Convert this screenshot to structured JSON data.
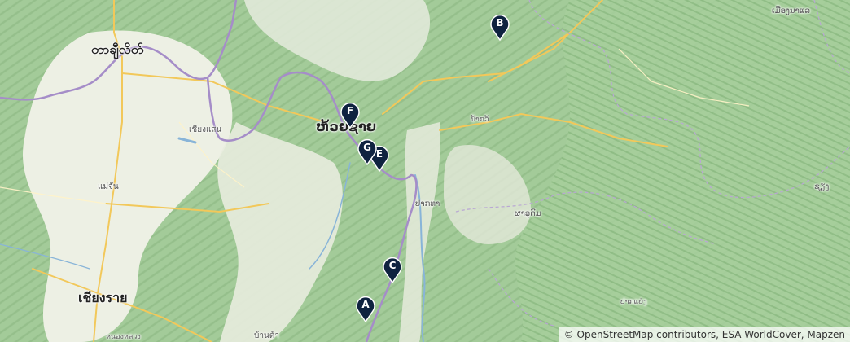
{
  "map": {
    "place_labels": [
      {
        "id": "tachileik",
        "text": "တာချီလိတ်"
      },
      {
        "id": "huay-xai",
        "text": "ຫ້ວຍຊາຍ"
      },
      {
        "id": "chiang-saen",
        "text": "เชียงแสน"
      },
      {
        "id": "mae-chan",
        "text": "แม่จัน"
      },
      {
        "id": "chiang-rai",
        "text": "เชียงราย"
      },
      {
        "id": "pak-tha",
        "text": "ປາກທາ"
      },
      {
        "id": "nam-kwe",
        "text": "ນໍ້າກວ້"
      },
      {
        "id": "pha-oudom",
        "text": "ຜາອຸດົມ"
      },
      {
        "id": "pak-beng",
        "text": "ປາກແບ່ງ"
      },
      {
        "id": "ban-don",
        "text": "บ้านต้า"
      },
      {
        "id": "nong-luang",
        "text": "หนองหลวง"
      },
      {
        "id": "muang-sing",
        "text": "ເມືອງນາແລ"
      },
      {
        "id": "oudomxay",
        "text": "ຊຽງ"
      }
    ],
    "markers": [
      {
        "id": "A",
        "label": "A"
      },
      {
        "id": "B",
        "label": "B"
      },
      {
        "id": "C",
        "label": "C"
      },
      {
        "id": "E",
        "label": "E"
      },
      {
        "id": "F",
        "label": "F"
      },
      {
        "id": "G",
        "label": "G"
      }
    ],
    "colors": {
      "forest": "#a9cfa0",
      "forest_dark": "#8fbf86",
      "plain": "#eef0e6",
      "river": "#8ab6d9",
      "border": "#a98ec4",
      "road": "#f3cf6b",
      "marker": "#0f2340"
    }
  },
  "attribution": {
    "copyright": "© OpenStreetMap contributors, ESA WorldCover, Mapzen"
  }
}
